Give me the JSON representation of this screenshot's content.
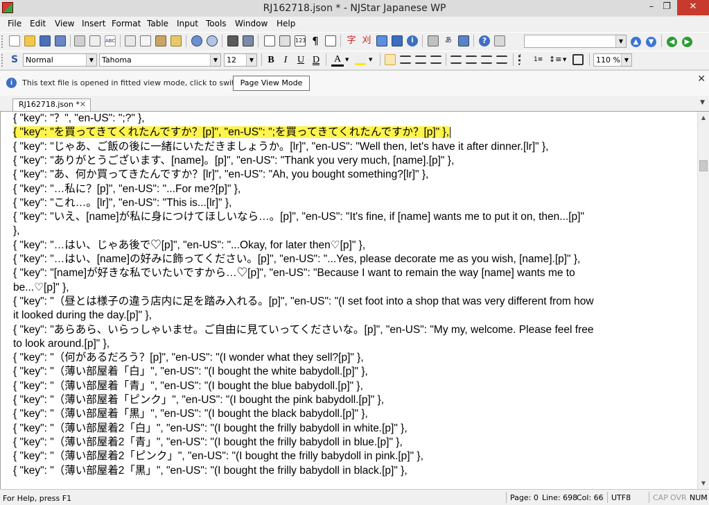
{
  "window": {
    "title": "RJ162718.json * - NJStar Japanese WP",
    "controls": [
      "–",
      "❐",
      "✕"
    ]
  },
  "menu": [
    "File",
    "Edit",
    "View",
    "Insert",
    "Format",
    "Table",
    "Input",
    "Tools",
    "Window",
    "Help"
  ],
  "toolbar2": {
    "style": "Normal",
    "font": "Tahoma",
    "size": "12",
    "zoom": "110 %"
  },
  "infobar": {
    "message": "This text file is opened in fitted view mode, click to switch",
    "button": "Page View Mode",
    "close": "✕"
  },
  "tabs": [
    {
      "label": "RJ162718.json *",
      "close": "✕"
    }
  ],
  "editor": {
    "lines": [
      "    { \"key\": \"？\", \"en-US\": \";?\" },",
      "    { \"key\": \"を買ってきてくれたんですか？[p]\", \"en-US\": \";を買ってきてくれたんですか？[p]\" },",
      "    { \"key\": \"じゃあ、ご飯の後に一緒にいただきましょうか。[lr]\", \"en-US\": \"Well then, let's have it after dinner.[lr]\" },",
      "    { \"key\": \"ありがとうございます、[name]。[p]\", \"en-US\": \"Thank you very much, [name].[p]\" },",
      "    { \"key\": \"あ、何か買ってきたんですか？[lr]\", \"en-US\": \"Ah, you bought something?[lr]\" },",
      "    { \"key\": \"…私に？[p]\", \"en-US\": \"...For me?[p]\" },",
      "    { \"key\": \"これ…。[lr]\", \"en-US\": \"This is...[lr]\" },",
      "    { \"key\": \"いえ、[name]が私に身につけてほしいなら…。[p]\", \"en-US\": \"It's fine, if [name] wants me to put it on, then...[p]\"",
      "},",
      "    { \"key\": \"…はい、じゃあ後で♡[p]\", \"en-US\": \"...Okay, for later then♡[p]\" },",
      "    { \"key\": \"…はい、[name]の好みに飾ってください。[p]\", \"en-US\": \"...Yes, please decorate me as you wish, [name].[p]\" },",
      "    { \"key\": \"[name]が好きな私でいたいですから…♡[p]\", \"en-US\": \"Because I want to remain the way [name] wants me to",
      "be...♡[p]\" },",
      "    { \"key\": \"（昼とは様子の違う店内に足を踏み入れる。[p]\", \"en-US\": \"(I set foot into a shop that was very different from how",
      "it looked during the day.[p]\" },",
      "    { \"key\": \"あらあら、いらっしゃいませ。ご自由に見ていってくださいな。[p]\", \"en-US\": \"My my, welcome. Please feel free",
      "to look around.[p]\" },",
      "    { \"key\": \"（何があるだろう？[p]\", \"en-US\": \"(I wonder what they sell?[p]\" },",
      "    { \"key\": \"（薄い部屋着「白」\", \"en-US\": \"(I bought the white babydoll.[p]\" },",
      "    { \"key\": \"（薄い部屋着「青」\", \"en-US\": \"(I bought the blue babydoll.[p]\" },",
      "    { \"key\": \"（薄い部屋着「ピンク」\", \"en-US\": \"(I bought the pink babydoll.[p]\" },",
      "    { \"key\": \"（薄い部屋着「黒」\", \"en-US\": \"(I bought the black babydoll.[p]\" },",
      "    { \"key\": \"（薄い部屋着2「白」\", \"en-US\": \"(I bought the frilly babydoll in white.[p]\" },",
      "    { \"key\": \"（薄い部屋着2「青」\", \"en-US\": \"(I bought the frilly babydoll in blue.[p]\" },",
      "    { \"key\": \"（薄い部屋着2「ピンク」\", \"en-US\": \"(I bought the frilly babydoll in pink.[p]\" },",
      "    { \"key\": \"（薄い部屋着2「黒」\", \"en-US\": \"(I bought the frilly babydoll in black.[p]\" },"
    ],
    "highlighted_line": 1,
    "highlight_color": "#fff34d"
  },
  "status": {
    "help": "For Help, press F1",
    "page": "Page: 0",
    "line": "Line: 698",
    "col": "Col: 66",
    "encoding": "UTF8",
    "cap": "CAP",
    "ovr": "OVR",
    "num": "NUM"
  }
}
